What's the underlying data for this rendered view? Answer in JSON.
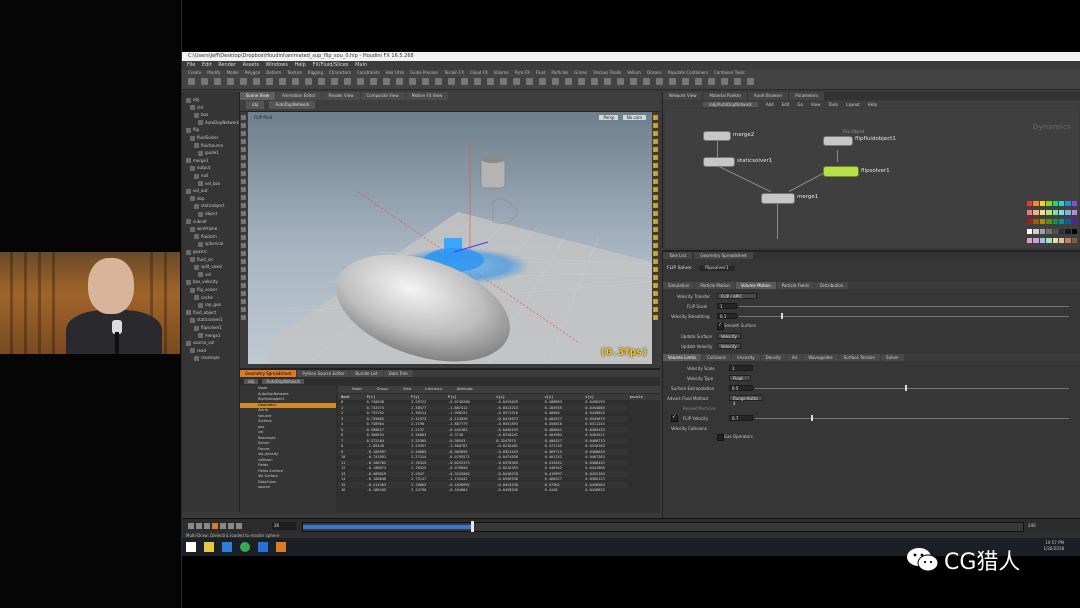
{
  "window": {
    "title": "C:\\Users\\Jeff\\Desktop\\Dropbox\\Houdini\\animated_sup_flip_sou_0.hip - Houdini FX 16.5.268",
    "menu": [
      "File",
      "Edit",
      "Render",
      "Assets",
      "Windows",
      "Help",
      "FX/Fluid/Slices",
      "Main"
    ]
  },
  "shelf": {
    "tabs": [
      "Create",
      "Modify",
      "Model",
      "Polygon",
      "Deform",
      "Texture",
      "Rigging",
      "Characters",
      "Constraints",
      "Hair Utils",
      "Guide Process",
      "Terrain FX",
      "Cloud FX",
      "Volume",
      "Pyro FX",
      "Fluid",
      "Particles",
      "Grains",
      "Viscous Fluids",
      "Vellum",
      "Oceans",
      "Populate Containers",
      "Container Tools"
    ]
  },
  "tree": {
    "items": [
      "obj",
      "ctrl",
      "box",
      "AutoDopNetwork",
      "flip",
      "fluidSolver",
      "fluidsource",
      "guide1",
      "merge1",
      "output",
      "null",
      "vel_box",
      "vel_out",
      "dop",
      "staticobject",
      "object",
      "subnet",
      "wireframe",
      "fluidsim",
      "spherical",
      "goalsrc",
      "fluid_src",
      "split_voxel",
      "vel",
      "box_velocity",
      "flip_solver",
      "cache",
      "rop_geo",
      "fluid_object",
      "staticsolver1",
      "flipsolver1",
      "merge1",
      "source_vol",
      "read",
      "resample"
    ]
  },
  "viewport": {
    "tabs": [
      "Scene View",
      "Animation Editor",
      "Render View",
      "Composite View",
      "Motion FX View"
    ],
    "path": [
      "obj",
      "AutoDopNetwork"
    ],
    "camera_label": "Persp",
    "view_buttons": [
      "Persp",
      "No cam"
    ],
    "label": "FLIP fluid",
    "fps": "(0.3fps)"
  },
  "spreadsheet": {
    "tabs": [
      "Geometry Spreadsheet",
      "Python Source Editor",
      "Bundle List",
      "Data Tree"
    ],
    "path": [
      "obj",
      "AutoDopNetwork"
    ],
    "tree": [
      "Node",
      "AutoDopNetwork",
      "flipfluidobject1",
      "Geometry",
      "Attrib",
      "Volume",
      "Surface",
      "pos",
      "vel",
      "Resample",
      "Solver",
      "Forces",
      "vel_density",
      "collision",
      "Fields",
      "Fields Surface",
      "Vel Surface",
      "DataCube",
      "source"
    ],
    "toolbar": [
      "Node:",
      "Group:",
      "View",
      "Intrinsics:",
      "Attribute"
    ],
    "columns": [
      "Node",
      "P[x]",
      "P[y]",
      "P[z]",
      "v[x]",
      "v[y]",
      "v[z]",
      "pscale"
    ],
    "rows": [
      [
        "0",
        "0.748048",
        "2.29722",
        "-0.0746280",
        "-0.0476029",
        "0.188893",
        "0.0496293"
      ],
      [
        "1",
        "0.732574",
        "2.38577",
        "-1.887412",
        "-0.0513215",
        "0.184935",
        "0.0454085"
      ],
      [
        "2",
        "0.735782",
        "2.30214",
        "-1.998251",
        "-0.0571516",
        "0.48004",
        "0.0448825"
      ],
      [
        "3",
        "0.735883",
        "2.32373",
        "-0.122026",
        "-0.0415673",
        "0.404377",
        "0.0345679"
      ],
      [
        "4",
        "0.758904",
        "2.2198",
        "-1.887779",
        "-0.0551893",
        "0.456816",
        "0.0311245"
      ],
      [
        "5",
        "0.396617",
        "2.2137",
        "-0.445182",
        "-0.0456193",
        "0.468041",
        "0.0305433"
      ],
      [
        "6",
        "0.308654",
        "2.30803",
        "-0.3748",
        "-0.0318241",
        "0.404984",
        "0.0464521"
      ],
      [
        "7",
        "0.372184",
        "2.25305",
        "-0.38543",
        "0.3247975",
        "0.400327",
        "0.0408713"
      ],
      [
        "8",
        "-1.89428",
        "2.29397",
        "-1.588787",
        "-0.0216401",
        "0.371745",
        "0.0316283"
      ],
      [
        "9",
        "-0.185997",
        "2.30885",
        "-0.365095",
        "-0.0321543",
        "0.369715",
        "0.0368635"
      ],
      [
        "10",
        "-0.741091",
        "2.27314",
        "-0.0793571",
        "-0.0474838",
        "0.401152",
        "0.0407363"
      ],
      [
        "11",
        "-0.106702",
        "2.76325",
        "-0.0252373",
        "-0.0378363",
        "0.413451",
        "0.0488432"
      ],
      [
        "12",
        "-0.108074",
        "2.76325",
        "-0.476058",
        "-0.0216353",
        "0.446342",
        "0.0441068"
      ],
      [
        "13",
        "-0.409819",
        "2.2947",
        "-0.3243562",
        "-0.0418978",
        "0.419997",
        "0.0432163"
      ],
      [
        "14",
        "-0.180848",
        "2.75147",
        "-1.135442",
        "-0.0558338",
        "0.468527",
        "0.0366123"
      ],
      [
        "15",
        "-0.414303",
        "2.70065",
        "-0.1028992",
        "-0.0414538",
        "0.37962",
        "0.0446563"
      ],
      [
        "16",
        "-0.186205",
        "2.24790",
        "-0.164084",
        "-0.0438536",
        "0.4446",
        "0.0436633"
      ]
    ]
  },
  "timeline": {
    "frame": "26",
    "start": "1",
    "end": "240",
    "fps": "120"
  },
  "status": "Multi-Draw: Dielectric loaded to master sphere",
  "node_graph": {
    "tabs": [
      "Network View",
      "Material Palette",
      "Asset Browser",
      "Parameters"
    ],
    "path": "/obj/AutoDopNetwork",
    "menu": [
      "Add",
      "Edit",
      "Go",
      "View",
      "Tools",
      "Layout",
      "Help"
    ],
    "context_label": "Dynamics",
    "nodes": [
      {
        "name": "merge2"
      },
      {
        "name": "staticsolver1"
      },
      {
        "name": "flipfluidobject1",
        "subtitle": "Flip Object"
      },
      {
        "name": "flipsolver1"
      },
      {
        "name": "merge1"
      }
    ]
  },
  "params": {
    "tabs": [
      "Take List",
      "Geometry Spreadsheet"
    ],
    "node_type": "FLIP Solver",
    "node_name": "flipsolver1",
    "tabs1": [
      "Simulation",
      "Particle Motion",
      "Volume Motion",
      "Particle Fields",
      "Distribution"
    ],
    "tabs2": [
      "Volume Limits",
      "Collisions",
      "Viscosity",
      "Density",
      "Air",
      "Waveguides",
      "Surface Tension",
      "Solver"
    ],
    "labels": {
      "velocity_transfer": "Velocity Transfer",
      "velocity_transfer_val": "FLIP / APIC",
      "flip_scale": "FLIP Scale",
      "flip_scale_val": "1",
      "velocity_smoothing": "Velocity Smoothing",
      "velocity_smoothing_val": "0.1",
      "smooth_surface": "Smooth Surface",
      "update_surface": "Update Surface",
      "update_surface_val": "Velocity",
      "update_velocity": "Update Velocity",
      "update_velocity_val": "Velocity",
      "velocity_scale": "Velocity Scale",
      "velocity_scale_val": "1",
      "velocity_type": "Velocity Type",
      "velocity_type_val": "Float",
      "surface_extrapolation": "Surface Extrapolation",
      "surface_extrapolation_val": "0.5",
      "advect_fluid_method": "Advect Fluid Method",
      "advect_fluid_method_val": "Runge-Kutta 4",
      "reseed_particles": "Reseed Particles",
      "flip_velocity": "FLIP Velocity",
      "flip_velocity_val": "0.7",
      "velocity_collisions": "Velocity Collisions",
      "gas_operators": "Gas Operators"
    }
  },
  "taskbar": {
    "clock_time": "10:57 PM",
    "clock_date": "1/26/2018"
  },
  "watermark": {
    "text": "CG猎人"
  },
  "colors": {
    "accent": "#d97b2a",
    "node_selected": "#b6e04a",
    "fps_text": "#ffcc00",
    "particles": "#3ea6f0"
  }
}
